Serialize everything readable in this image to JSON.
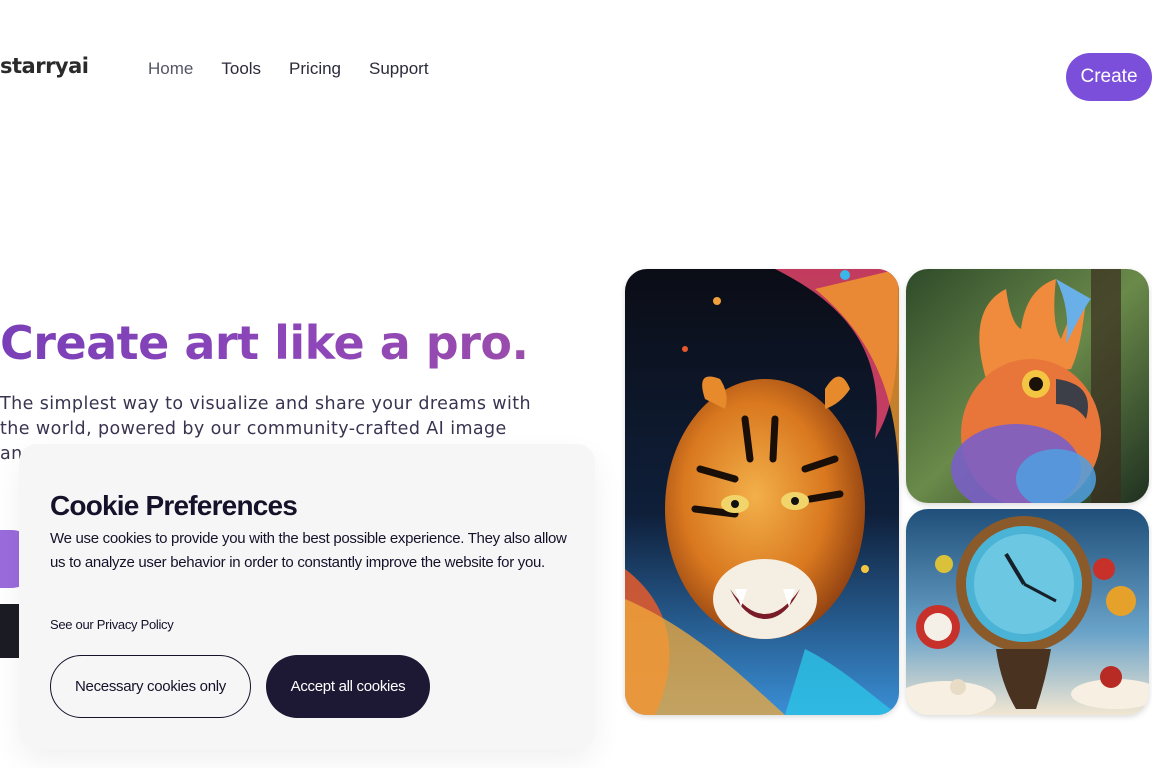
{
  "header": {
    "logo": "starryai",
    "nav": [
      {
        "label": "Home"
      },
      {
        "label": "Tools"
      },
      {
        "label": "Pricing"
      },
      {
        "label": "Support"
      }
    ],
    "create_label": "Create"
  },
  "hero": {
    "title": "Create art like a pro.",
    "subtitle": "The simplest way to visualize and share your dreams with the world, powered by our community-crafted AI image and video sty"
  },
  "gallery": {
    "images": [
      {
        "icon": "tiger-artwork"
      },
      {
        "icon": "bird-artwork"
      },
      {
        "icon": "melting-clock-artwork"
      }
    ]
  },
  "cookie_banner": {
    "title": "Cookie Preferences",
    "description": "We use cookies to provide you with the best possible experience. They also allow us to analyze user behavior in order to constantly improve the website for you.",
    "policy_link": "See our Privacy Policy",
    "necessary_label": "Necessary cookies only",
    "accept_label": "Accept all cookies"
  },
  "colors": {
    "accent": "#7b4fd9",
    "title_gradient_start": "#7a3fb8",
    "banner_bg": "#f6f6f6",
    "dark_button": "#1d1833"
  }
}
